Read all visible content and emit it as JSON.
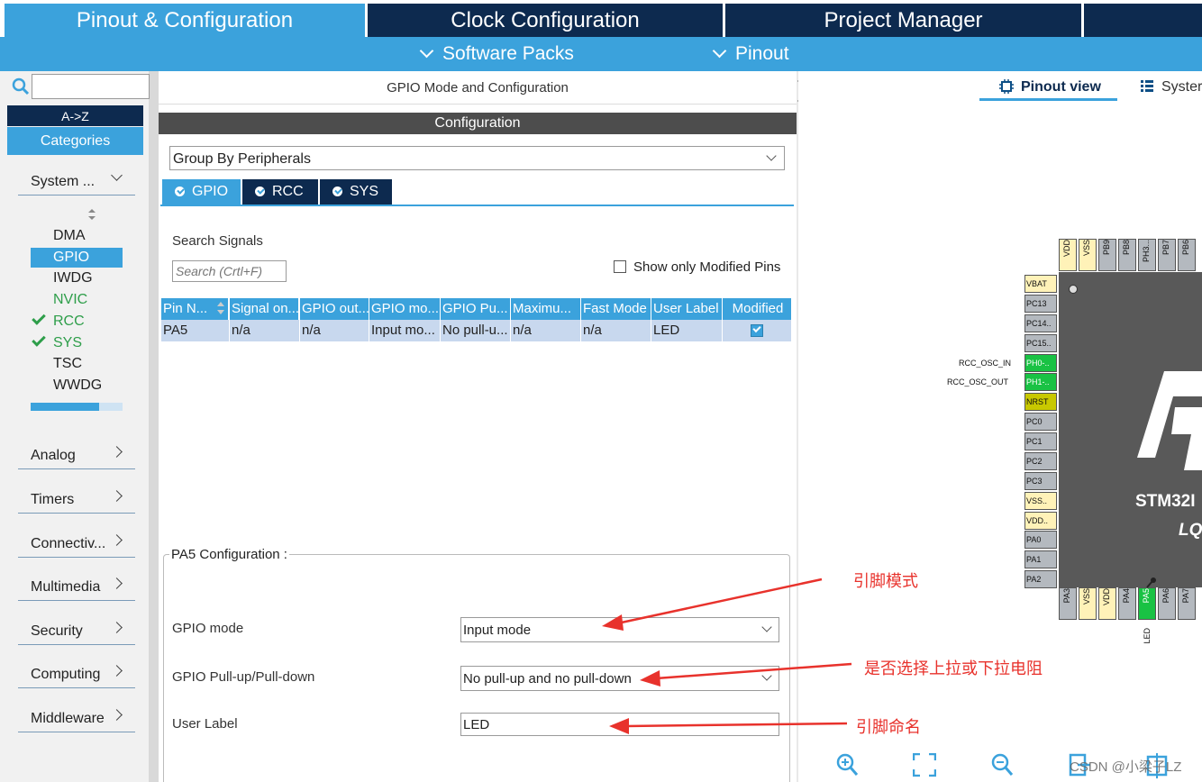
{
  "top_tabs": [
    "Pinout & Configuration",
    "Clock Configuration",
    "Project Manager"
  ],
  "sub_menu": [
    "Software Packs",
    "Pinout"
  ],
  "left": {
    "az": "A->Z",
    "categories": "Categories",
    "system_header": "System ...",
    "system_items": [
      "DMA",
      "GPIO",
      "IWDG",
      "NVIC",
      "RCC",
      "SYS",
      "TSC",
      "WWDG"
    ],
    "groups": [
      "Analog",
      "Timers",
      "Connectiv...",
      "Multimedia",
      "Security",
      "Computing",
      "Middleware"
    ]
  },
  "middle": {
    "header": "GPIO Mode and Configuration",
    "config_bar": "Configuration",
    "group_select": "Group By Peripherals",
    "tabs": [
      "GPIO",
      "RCC",
      "SYS"
    ],
    "search_label": "Search Signals",
    "search_placeholder": "Search (Crtl+F)",
    "show_modified": "Show only Modified Pins",
    "table": {
      "headers": [
        "Pin N...",
        "Signal on...",
        "GPIO out...",
        "GPIO mo...",
        "GPIO Pu...",
        "Maximu...",
        "Fast Mode",
        "User Label",
        "Modified"
      ],
      "row": [
        "PA5",
        "n/a",
        "n/a",
        "Input mo...",
        "No pull-u...",
        "n/a",
        "n/a",
        "LED"
      ]
    },
    "pa5_legend": "PA5 Configuration :",
    "gpio_mode_label": "GPIO mode",
    "gpio_mode_value": "Input mode",
    "pull_label": "GPIO Pull-up/Pull-down",
    "pull_value": "No pull-up and no pull-down",
    "user_label": "User Label",
    "user_label_value": "LED"
  },
  "right": {
    "pinout_view": "Pinout view",
    "system_view": "Syster",
    "left_pins": [
      "VBAT",
      "PC13",
      "PC14..",
      "PC15..",
      "PH0-..",
      "PH1-..",
      "NRST",
      "PC0",
      "PC1",
      "PC2",
      "PC3",
      "VSS..",
      "VDD..",
      "PA0",
      "PA1",
      "PA2"
    ],
    "top_pins": [
      "VDD",
      "VSS",
      "PB9",
      "PB8",
      "PH3...",
      "PB7",
      "PB6"
    ],
    "bottom_pins": [
      "PA3",
      "VSS",
      "VDD",
      "PA4",
      "PA5",
      "PA6",
      "PA7"
    ],
    "rcc_osc_in": "RCC_OSC_IN",
    "rcc_osc_out": "RCC_OSC_OUT",
    "chip_text1": "STM32I",
    "chip_text2": "LQ",
    "led_label": "LED",
    "watermark": "CSDN @小梁子LZ"
  },
  "annotations": {
    "mode": "引脚模式",
    "pull": "是否选择上拉或下拉电阻",
    "name": "引脚命名"
  },
  "colors": {
    "accent": "#3ba2dc",
    "navy": "#0d2a4f",
    "pin_green": "#19c244",
    "pin_yellow_power": "#fff2b8",
    "pin_nrst": "#c8c800",
    "annotation_red": "#e8322c"
  }
}
